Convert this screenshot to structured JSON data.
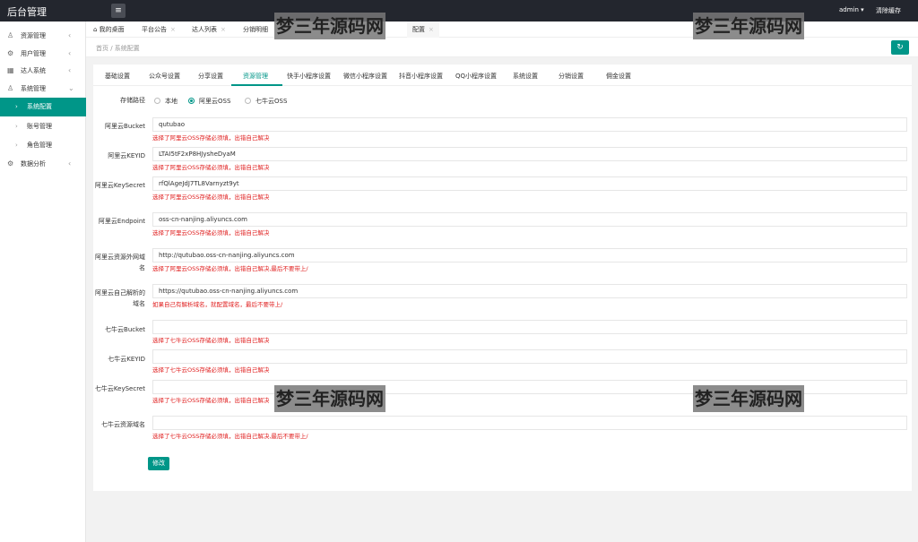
{
  "header": {
    "title": "后台管理",
    "menu_icon": "≡",
    "user": "admin ▾",
    "clear_cache": "清除缓存"
  },
  "sidebar": {
    "items": [
      {
        "icon": "person-icon",
        "glyph": "♙",
        "label": "资源管理",
        "arrow": "‹"
      },
      {
        "icon": "gear-icon",
        "glyph": "⚙",
        "label": "用户管理",
        "arrow": "‹"
      },
      {
        "icon": "grid-icon",
        "glyph": "▦",
        "label": "达人系统",
        "arrow": "‹"
      },
      {
        "icon": "users-icon",
        "glyph": "♙",
        "label": "系统管理",
        "arrow": "⌄"
      }
    ],
    "subitems": [
      {
        "label": "系统配置",
        "arrow": "›",
        "active": true
      },
      {
        "label": "账号管理",
        "arrow": "›",
        "active": false
      },
      {
        "label": "角色管理",
        "arrow": "›",
        "active": false
      }
    ],
    "last_item": {
      "icon": "chart-icon",
      "glyph": "⚙",
      "label": "数据分析",
      "arrow": "‹"
    }
  },
  "tabs": [
    {
      "label": "⌂ 我的桌面",
      "close": ""
    },
    {
      "label": "平台公告",
      "close": "×"
    },
    {
      "label": "达人列表",
      "close": "×"
    },
    {
      "label": "分销明细",
      "close": ""
    },
    {
      "label": "配置",
      "close": "×"
    }
  ],
  "breadcrumb": "首页 / 系统配置",
  "refresh_icon": "↻",
  "subtabs": [
    "基础设置",
    "公众号设置",
    "分享设置",
    "资源管理",
    "快手小程序设置",
    "微信小程序设置",
    "抖音小程序设置",
    "QQ小程序设置",
    "系统设置",
    "分销设置",
    "佣金设置"
  ],
  "active_subtab": "资源管理",
  "form": {
    "storage_label": "存储路径",
    "storage_options": [
      "本地",
      "阿里云OSS",
      "七牛云OSS"
    ],
    "storage_selected": "阿里云OSS",
    "fields": [
      {
        "label": "阿里云Bucket",
        "value": "qutubao",
        "tip": "选择了阿里云OSS存储必须填，出错自己解决"
      },
      {
        "label": "阿里云KEYID",
        "value": "LTAI5tF2xP8HJysheDyaM",
        "tip": "选择了阿里云OSS存储必须填，出错自己解决"
      },
      {
        "label": "阿里云KeySecret",
        "value": "rfQlAgeJdJ7TL8Varnyzt9yt",
        "tip": "选择了阿里云OSS存储必须填，出错自己解决"
      },
      {
        "label": "阿里云Endpoint",
        "value": "oss-cn-nanjing.aliyuncs.com",
        "tip": "选择了阿里云OSS存储必须填，出错自己解决"
      },
      {
        "label": "阿里云资源外网域名",
        "value": "http://qutubao.oss-cn-nanjing.aliyuncs.com",
        "tip": "选择了阿里云OSS存储必须填，出错自己解决,最后不要带上/"
      },
      {
        "label": "阿里云自己解析的域名",
        "value": "https://qutubao.oss-cn-nanjing.aliyuncs.com",
        "tip": "如果自己有解析域名，就配置域名，最后不要带上/"
      },
      {
        "label": "七牛云Bucket",
        "value": "",
        "tip": "选择了七牛云OSS存储必须填，出错自己解决"
      },
      {
        "label": "七牛云KEYID",
        "value": "",
        "tip": "选择了七牛云OSS存储必须填，出错自己解决"
      },
      {
        "label": "七牛云KeySecret",
        "value": "",
        "tip": "选择了七牛云OSS存储必须填，出错自己解决"
      },
      {
        "label": "七牛云资源域名",
        "value": "",
        "tip": "选择了七牛云OSS存储必须填，出错自己解决,最后不要带上/"
      }
    ],
    "submit_label": "修改"
  },
  "watermark": "梦三年源码网",
  "colors": {
    "accent": "#009688",
    "header_bg": "#23262e",
    "tip_red": "#e02020"
  }
}
